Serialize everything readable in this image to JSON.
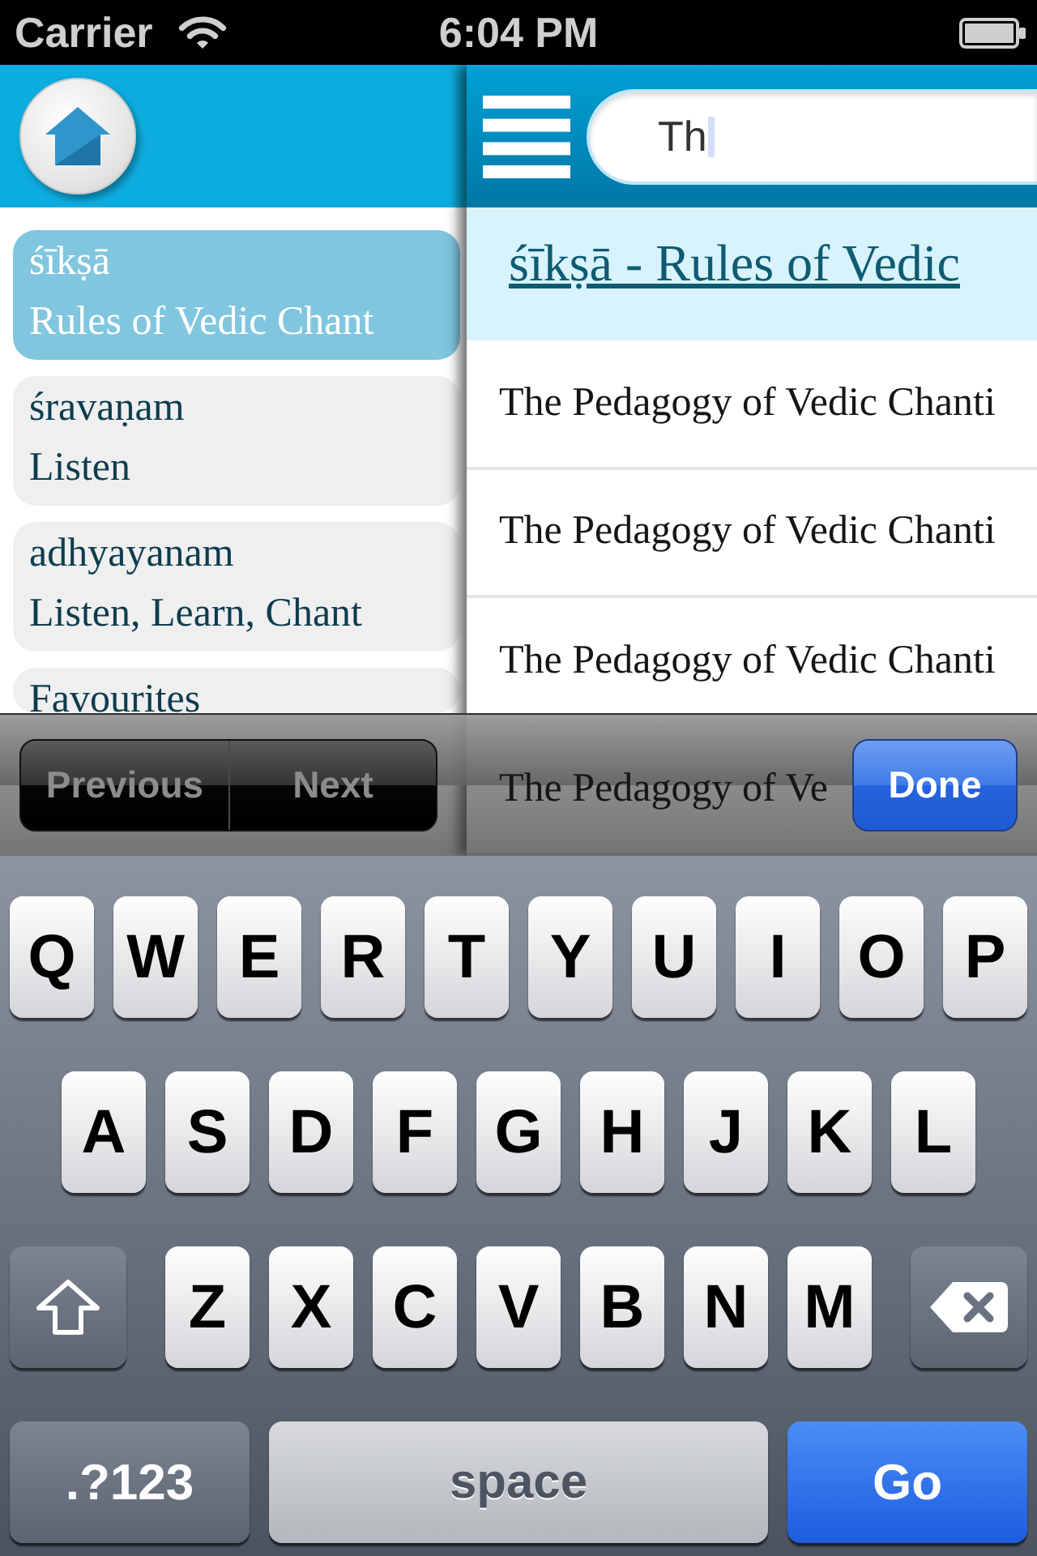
{
  "status_bar": {
    "carrier": "Carrier",
    "time": "6:04 PM"
  },
  "sidebar": {
    "items": [
      {
        "title": "śīkṣā",
        "subtitle": "Rules of Vedic Chant",
        "selected": true
      },
      {
        "title": "śravaṇam",
        "subtitle": "Listen",
        "selected": false
      },
      {
        "title": "adhyayanam",
        "subtitle": "Listen, Learn, Chant",
        "selected": false
      },
      {
        "title": "Favourites",
        "selected": false
      }
    ]
  },
  "search": {
    "value": "Th"
  },
  "content": {
    "heading": "śīkṣā - Rules of Vedic",
    "rows": [
      "The Pedagogy of Vedic Chanti",
      "The Pedagogy of Vedic Chanti",
      "The Pedagogy of Vedic Chanti",
      "The Pedagogy of Ve"
    ]
  },
  "input_toolbar": {
    "previous": {
      "label": "Previous",
      "disabled": true
    },
    "next": {
      "label": "Next",
      "disabled": true
    },
    "done": "Done"
  },
  "keyboard": {
    "rows": [
      {
        "keys": [
          {
            "kind": "letter",
            "label": "Q"
          },
          {
            "kind": "letter",
            "label": "W"
          },
          {
            "kind": "letter",
            "label": "E"
          },
          {
            "kind": "letter",
            "label": "R"
          },
          {
            "kind": "letter",
            "label": "T"
          },
          {
            "kind": "letter",
            "label": "Y"
          },
          {
            "kind": "letter",
            "label": "U"
          },
          {
            "kind": "letter",
            "label": "I"
          },
          {
            "kind": "letter",
            "label": "O"
          },
          {
            "kind": "letter",
            "label": "P"
          }
        ]
      },
      {
        "keys": [
          {
            "kind": "letter",
            "label": "A"
          },
          {
            "kind": "letter",
            "label": "S"
          },
          {
            "kind": "letter",
            "label": "D"
          },
          {
            "kind": "letter",
            "label": "F"
          },
          {
            "kind": "letter",
            "label": "G"
          },
          {
            "kind": "letter",
            "label": "H"
          },
          {
            "kind": "letter",
            "label": "J"
          },
          {
            "kind": "letter",
            "label": "K"
          },
          {
            "kind": "letter",
            "label": "L"
          }
        ]
      },
      {
        "keys": [
          {
            "kind": "shift"
          },
          {
            "kind": "letter",
            "label": "Z"
          },
          {
            "kind": "letter",
            "label": "X"
          },
          {
            "kind": "letter",
            "label": "C"
          },
          {
            "kind": "letter",
            "label": "V"
          },
          {
            "kind": "letter",
            "label": "B"
          },
          {
            "kind": "letter",
            "label": "N"
          },
          {
            "kind": "letter",
            "label": "M"
          },
          {
            "kind": "delete"
          }
        ]
      },
      {
        "keys": [
          {
            "kind": "mode",
            "label": ".?123"
          },
          {
            "kind": "space",
            "label": "space"
          },
          {
            "kind": "go",
            "label": "Go"
          }
        ]
      }
    ]
  }
}
